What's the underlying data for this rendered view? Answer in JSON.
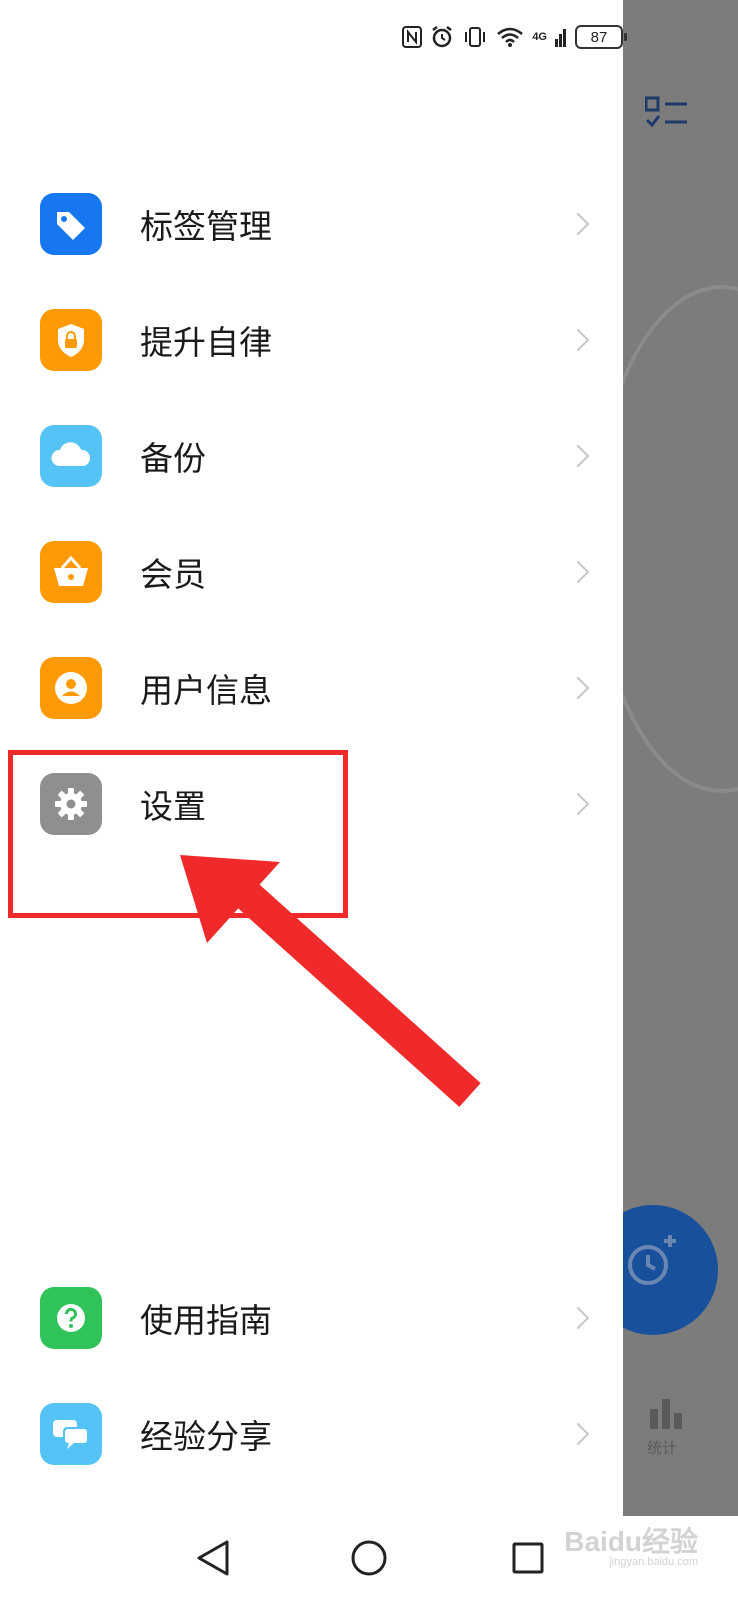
{
  "status_bar": {
    "network": "4G",
    "battery": "87"
  },
  "menu": {
    "items": [
      {
        "label": "标签管理",
        "icon": "tag-icon",
        "color": "#1677f0"
      },
      {
        "label": "提升自律",
        "icon": "lock-shield-icon",
        "color": "#ff9a06"
      },
      {
        "label": "备份",
        "icon": "cloud-icon",
        "color": "#55c3f5"
      },
      {
        "label": "会员",
        "icon": "basket-icon",
        "color": "#ff9a06"
      },
      {
        "label": "用户信息",
        "icon": "user-icon",
        "color": "#ff9a06"
      },
      {
        "label": "设置",
        "icon": "gear-icon",
        "color": "#8f8f8f"
      },
      {
        "label": "使用指南",
        "icon": "help-icon",
        "color": "#2fc35a"
      },
      {
        "label": "经验分享",
        "icon": "chat-icon",
        "color": "#55c3f5"
      }
    ]
  },
  "background_app": {
    "stats_label": "统计"
  },
  "watermark": {
    "brand": "Baidu经验",
    "url": "jingyan.baidu.com"
  },
  "colors": {
    "annotation": "#f02a2a",
    "accent": "#18509c"
  }
}
